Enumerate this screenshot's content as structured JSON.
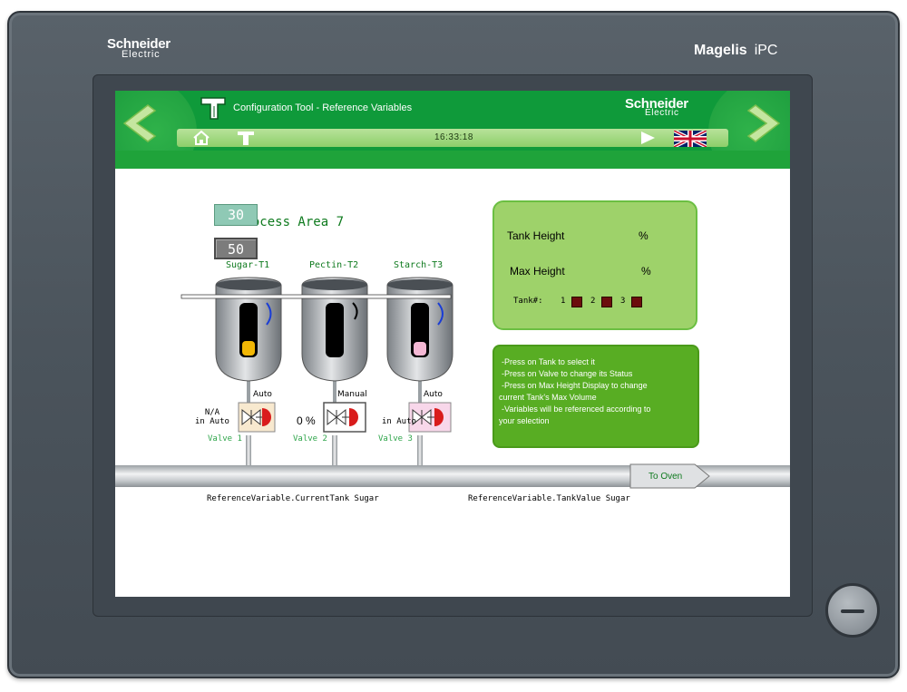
{
  "device": {
    "brand_line1": "Schneider",
    "brand_line2": "Electric",
    "model": "Magelis",
    "model_suffix": "iPC"
  },
  "header": {
    "title": "Configuration Tool - Reference Variables",
    "logo_line1": "Schneider",
    "logo_line2": "Electric",
    "time": "16:33:18"
  },
  "process": {
    "title": "Process Area 7",
    "tanks": [
      {
        "name": "Sugar-T1",
        "fill_color": "#f2b705",
        "fill_level": 0.28,
        "mode": "Auto",
        "valve": "Valve 1",
        "valve_bg": "#f8e9cf"
      },
      {
        "name": "Pectin-T2",
        "fill_color": "#000000",
        "fill_level": 0.0,
        "mode": "Manual",
        "valve": "Valve 2",
        "valve_bg": "#ffffff"
      },
      {
        "name": "Starch-T3",
        "fill_color": "#f4b8d4",
        "fill_level": 0.25,
        "mode": "Auto",
        "valve": "Valve 3",
        "valve_bg": "#f8d7ea"
      }
    ],
    "na_line1": "N/A",
    "na_line2": "in Auto",
    "percent_value": "0 %",
    "ref_current_tank": "ReferenceVariable.CurrentTank Sugar",
    "ref_tank_value": "ReferenceVariable.TankValue Sugar",
    "to_oven": "To Oven"
  },
  "height_panel": {
    "tank_height_label": "Tank Height",
    "tank_height_value": "30",
    "max_height_label": "Max Height",
    "max_height_value": "50",
    "unit": "%",
    "tank_num_label": "Tank#:",
    "tank_nums": [
      "1",
      "2",
      "3"
    ]
  },
  "instructions": [
    "-Press on Tank to select it",
    "-Press on Valve to change its Status",
    "-Press on Max Height Display to change",
    "current Tank's Max Volume",
    "-Variables will be referenced according to",
    "your selection"
  ],
  "colors": {
    "header_green": "#0f9a3a",
    "panel_green": "#9ed26a",
    "info_green": "#58ad23",
    "bezel": "#4b545c"
  }
}
